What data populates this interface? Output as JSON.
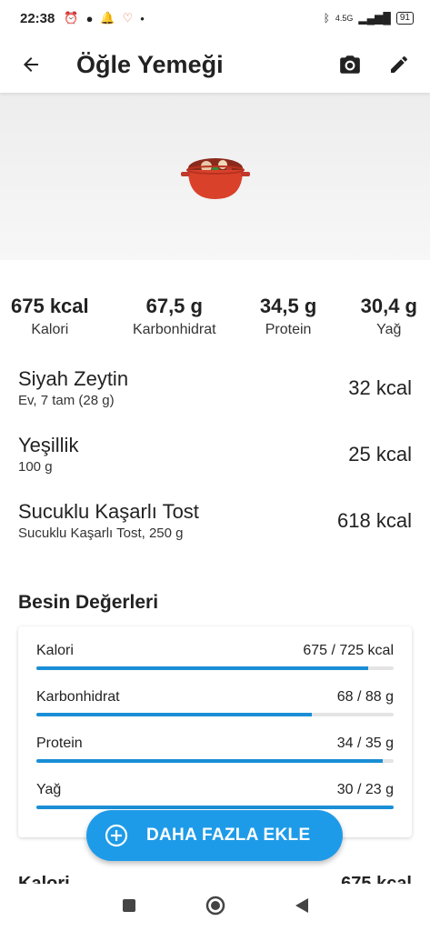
{
  "status": {
    "time": "22:38",
    "network": "4.5G",
    "battery": "91"
  },
  "appbar": {
    "title": "Öğle Yemeği"
  },
  "macros": [
    {
      "value": "675 kcal",
      "label": "Kalori"
    },
    {
      "value": "67,5 g",
      "label": "Karbonhidrat"
    },
    {
      "value": "34,5 g",
      "label": "Protein"
    },
    {
      "value": "30,4 g",
      "label": "Yağ"
    }
  ],
  "items": [
    {
      "name": "Siyah Zeytin",
      "detail": "Ev, 7 tam (28 g)",
      "kcal": "32 kcal"
    },
    {
      "name": "Yeşillik",
      "detail": "100 g",
      "kcal": "25 kcal"
    },
    {
      "name": "Sucuklu Kaşarlı Tost",
      "detail": "Sucuklu Kaşarlı Tost, 250 g",
      "kcal": "618 kcal"
    }
  ],
  "nutrition": {
    "title": "Besin Değerleri",
    "rows": [
      {
        "label": "Kalori",
        "value": "675 / 725 kcal",
        "progress": 0.93
      },
      {
        "label": "Karbonhidrat",
        "value": "68 / 88 g",
        "progress": 0.77
      },
      {
        "label": "Protein",
        "value": "34 / 35 g",
        "progress": 0.97
      },
      {
        "label": "Yağ",
        "value": "30 / 23 g",
        "progress": 1.0
      }
    ]
  },
  "fab": {
    "label": "DAHA FAZLA EKLE"
  },
  "peek": {
    "left": "Kalori",
    "right": "675 kcal"
  },
  "colors": {
    "accent": "#1e9be8",
    "bar_fill": "#1a8ed6",
    "bar_track": "#e4e4e4"
  }
}
